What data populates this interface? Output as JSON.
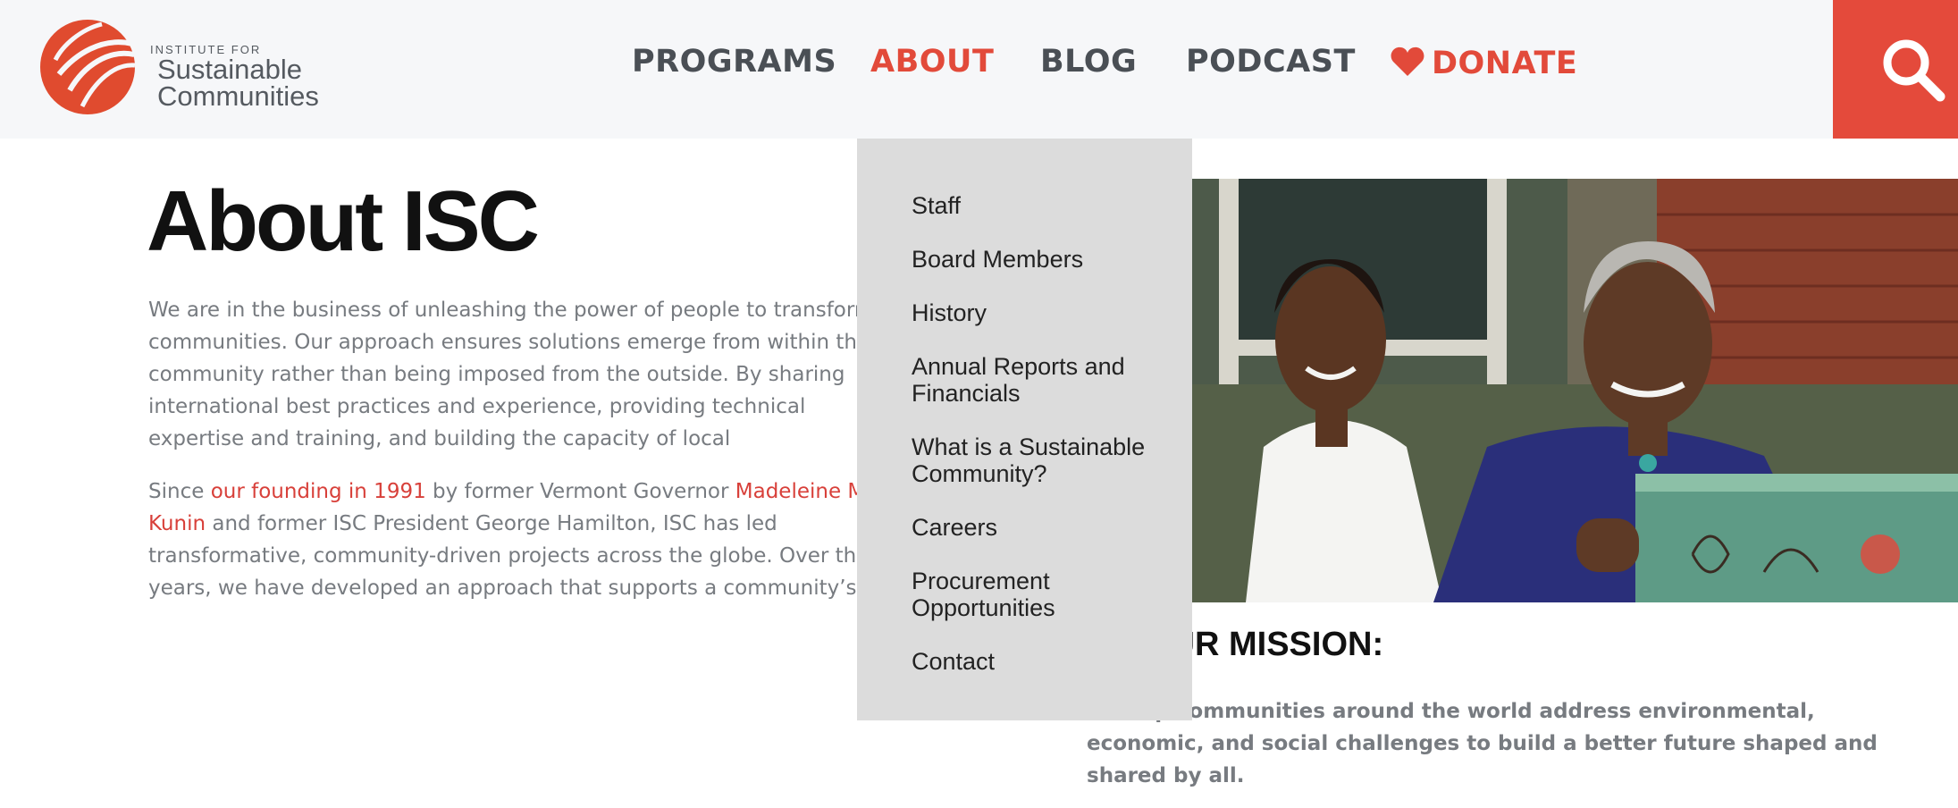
{
  "header": {
    "logo": {
      "small_text": "INSTITUTE FOR",
      "line1": "Sustainable",
      "line2": "Communities"
    },
    "nav": {
      "programs": "PROGRAMS",
      "about": "ABOUT",
      "blog": "BLOG",
      "podcast": "PODCAST",
      "donate": "DONATE"
    },
    "accent_color": "#e44a3b"
  },
  "dropdown": {
    "items": [
      "Staff",
      "Board Members",
      "History",
      "Annual Reports and Financials",
      "What is a Sustainable Community?",
      "Careers",
      "Procurement Opportunities",
      "Contact"
    ]
  },
  "main": {
    "title": "About ISC",
    "para1": "We are in the business of unleashing the power of people to transform communities. Our approach ensures solutions emerge from within the community rather than being imposed from the outside. By sharing international best practices and experience, providing technical expertise and training, and building the capacity of local organizations, we are sparking creative solutions and lasting change.",
    "para2_a": "Since ",
    "para2_link1": "our founding in 1991",
    "para2_b": " by former Vermont Governor ",
    "para2_link2": "Madeleine M. Kunin",
    "para2_c": " and former ISC President George Hamilton, ISC has led transformative, community-driven projects across the globe. Over the years, we have developed an approach that supports a community’s ability to meet challenges head on."
  },
  "mission": {
    "title": "OUR MISSION:",
    "text": "To help communities around the world address environmental, economic, and social challenges to build a better future shaped and shared by all."
  }
}
